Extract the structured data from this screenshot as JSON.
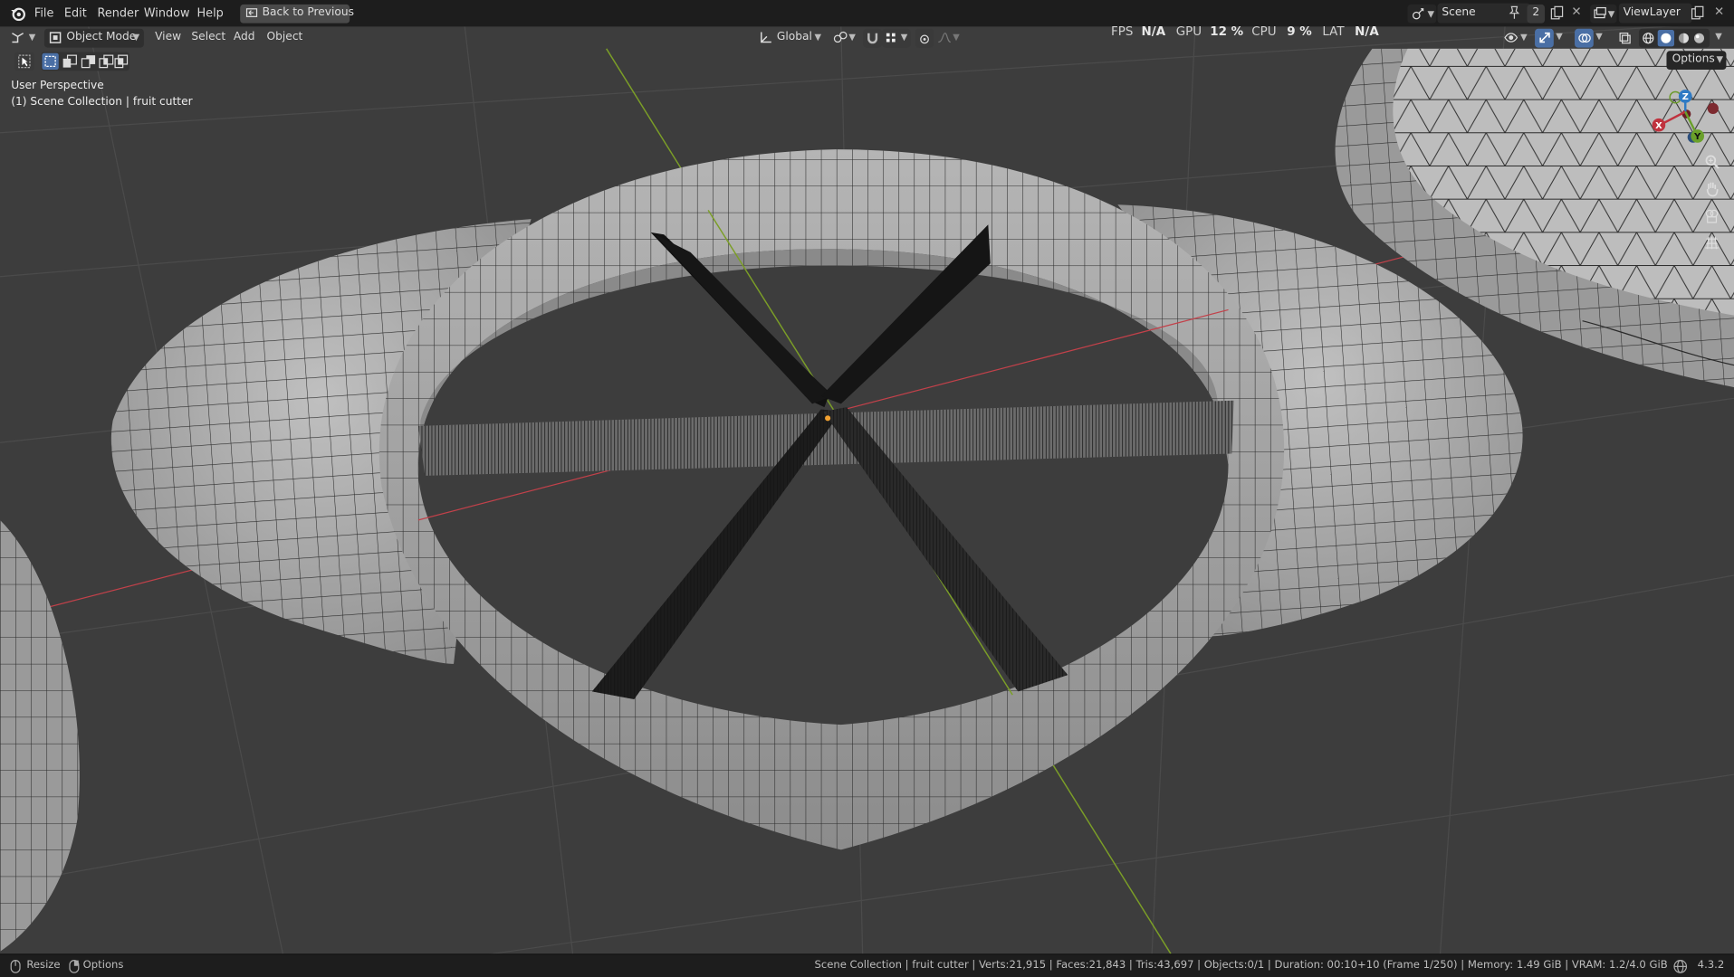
{
  "topbar": {
    "menus": [
      "File",
      "Edit",
      "Render",
      "Window",
      "Help"
    ],
    "back_button": "Back to Previous",
    "scene": {
      "value": "Scene",
      "count": "2"
    },
    "view_layer": "ViewLayer"
  },
  "viewport_header": {
    "mode": "Object Mode",
    "menus": [
      "View",
      "Select",
      "Add",
      "Object"
    ],
    "transform_orientation": "Global",
    "options_label": "Options"
  },
  "perf_overlay": {
    "fps_label": "FPS",
    "fps_value": "N/A",
    "gpu_label": "GPU",
    "gpu_value": "12 %",
    "cpu_label": "CPU",
    "cpu_value": "9 %",
    "lat_label": "LAT",
    "lat_value": "N/A"
  },
  "viewport_info": {
    "view_name": "User Perspective",
    "collection_line": "(1) Scene Collection | fruit cutter"
  },
  "gizmo": {
    "z": "Z",
    "x": "X",
    "y": "Y"
  },
  "icons": {
    "blender_logo": "blender-logo-icon",
    "back": "back-arrow-icon",
    "editor_type": "editor-type-icon",
    "mode": "object-mode-icon",
    "orientation": "transform-orientation-icon",
    "pivot": "pivot-point-icon",
    "snap": "snap-magnet-icon",
    "snap_grid": "snap-grid-icon",
    "proportional": "proportional-editing-icon",
    "falloff": "proportional-falloff-icon",
    "select_box": "select-box-icon",
    "visibility": "object-visibility-icon",
    "gizmos": "gizmo-toggle-icon",
    "overlays": "overlays-icon",
    "xray": "xray-icon",
    "shading": [
      "wireframe-shading-icon",
      "solid-shading-icon",
      "material-preview-icon",
      "rendered-shading-icon"
    ],
    "zoom": "zoom-icon",
    "pan": "pan-hand-icon",
    "camera": "camera-view-icon",
    "ortho": "orthographic-grid-icon",
    "scene": "scene-icon",
    "pin": "pin-icon",
    "new_scene": "new-scene-icon",
    "view_layer": "view-layer-icon",
    "new_layer": "new-view-layer-icon",
    "resize": "mouse-resize-icon",
    "options_mouse": "mouse-options-icon",
    "status_stats": "stats-icon"
  },
  "statusbar": {
    "left_items": [
      "Resize",
      "Options"
    ],
    "stats": "Scene Collection | fruit cutter | Verts:21,915 | Faces:21,843 | Tris:43,697 | Objects:0/1 | Duration: 00:10+10 (Frame 1/250) | Memory: 1.49 GiB | VRAM: 1.2/4.0 GiB",
    "version": "4.3.2"
  },
  "colors": {
    "viewport_bg": "#3d3d3d",
    "grid_line": "#4b4b4b",
    "axis_x": "#c2414a",
    "axis_y": "#7b9e27",
    "mesh_fill": "#9e9e9e",
    "wire": "#262626",
    "accent_blue": "#4a6fa5"
  }
}
